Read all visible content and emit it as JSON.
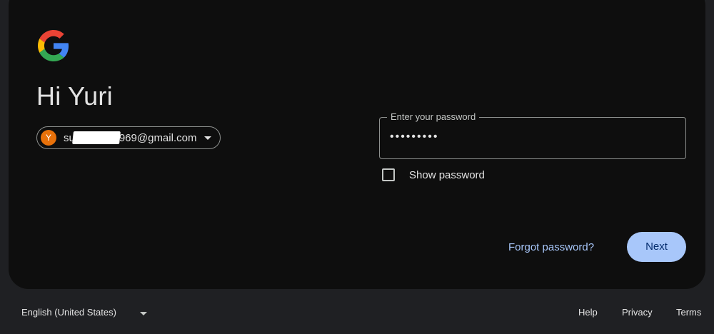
{
  "greeting": "Hi Yuri",
  "account": {
    "avatar_letter": "Y",
    "email_prefix": "su",
    "email_suffix": "969@gmail.com"
  },
  "password": {
    "label": "Enter your password",
    "masked_value": "•••••••••",
    "show_password_label": "Show password",
    "show_password_checked": false
  },
  "actions": {
    "forgot_label": "Forgot password?",
    "next_label": "Next"
  },
  "footer": {
    "language": "English (United States)",
    "help": "Help",
    "privacy": "Privacy",
    "terms": "Terms"
  },
  "icons": {
    "logo": "google-logo-icon",
    "chip_caret": "chevron-down-icon",
    "language_caret": "chevron-down-icon"
  },
  "colors": {
    "card_bg": "#0e0e0e",
    "page_bg": "#1f2023",
    "accent": "#a8c7fa",
    "avatar": "#e8710a"
  }
}
